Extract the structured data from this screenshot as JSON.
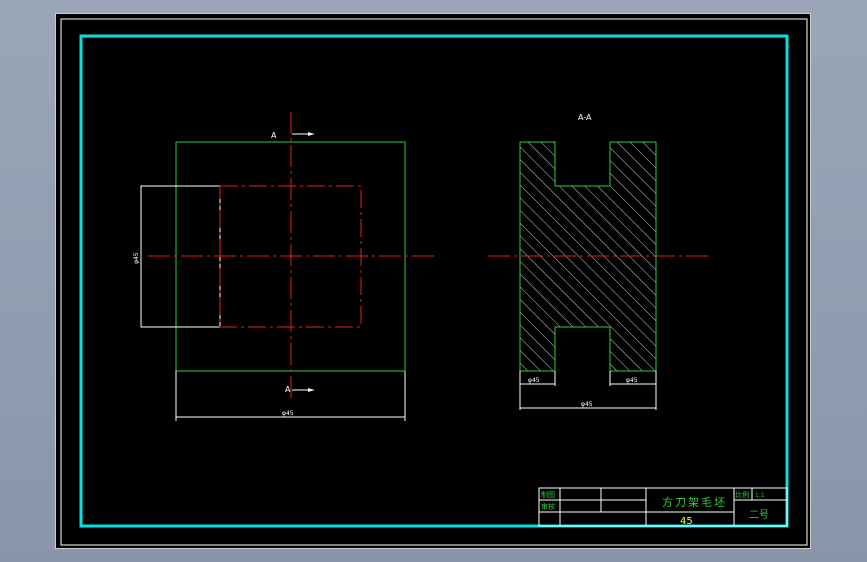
{
  "sheet": {
    "colors": {
      "frame": "#00e0e0",
      "outline": "#2ecc40",
      "centerline": "#e02020",
      "dimension": "#ffffff",
      "title_text": "#2ecc40",
      "material_text": "#ffff00"
    }
  },
  "drawing": {
    "section_marker_top": "A",
    "section_marker_bottom": "A",
    "section_view_label": "A-A",
    "front_view": {
      "dim_side_label": "φ45",
      "dim_width_label": "φ45"
    },
    "section_view": {
      "dim_bottom_left_label": "φ45",
      "dim_bottom_right_label": "φ45",
      "dim_overall_label": "φ45"
    }
  },
  "title_block": {
    "row1_label": "制图",
    "row2_label": "审核",
    "part_name": "方刀架毛坯",
    "material": "45",
    "scale_label": "比例",
    "scale_value": "1:1",
    "sheet_size": "二号"
  }
}
